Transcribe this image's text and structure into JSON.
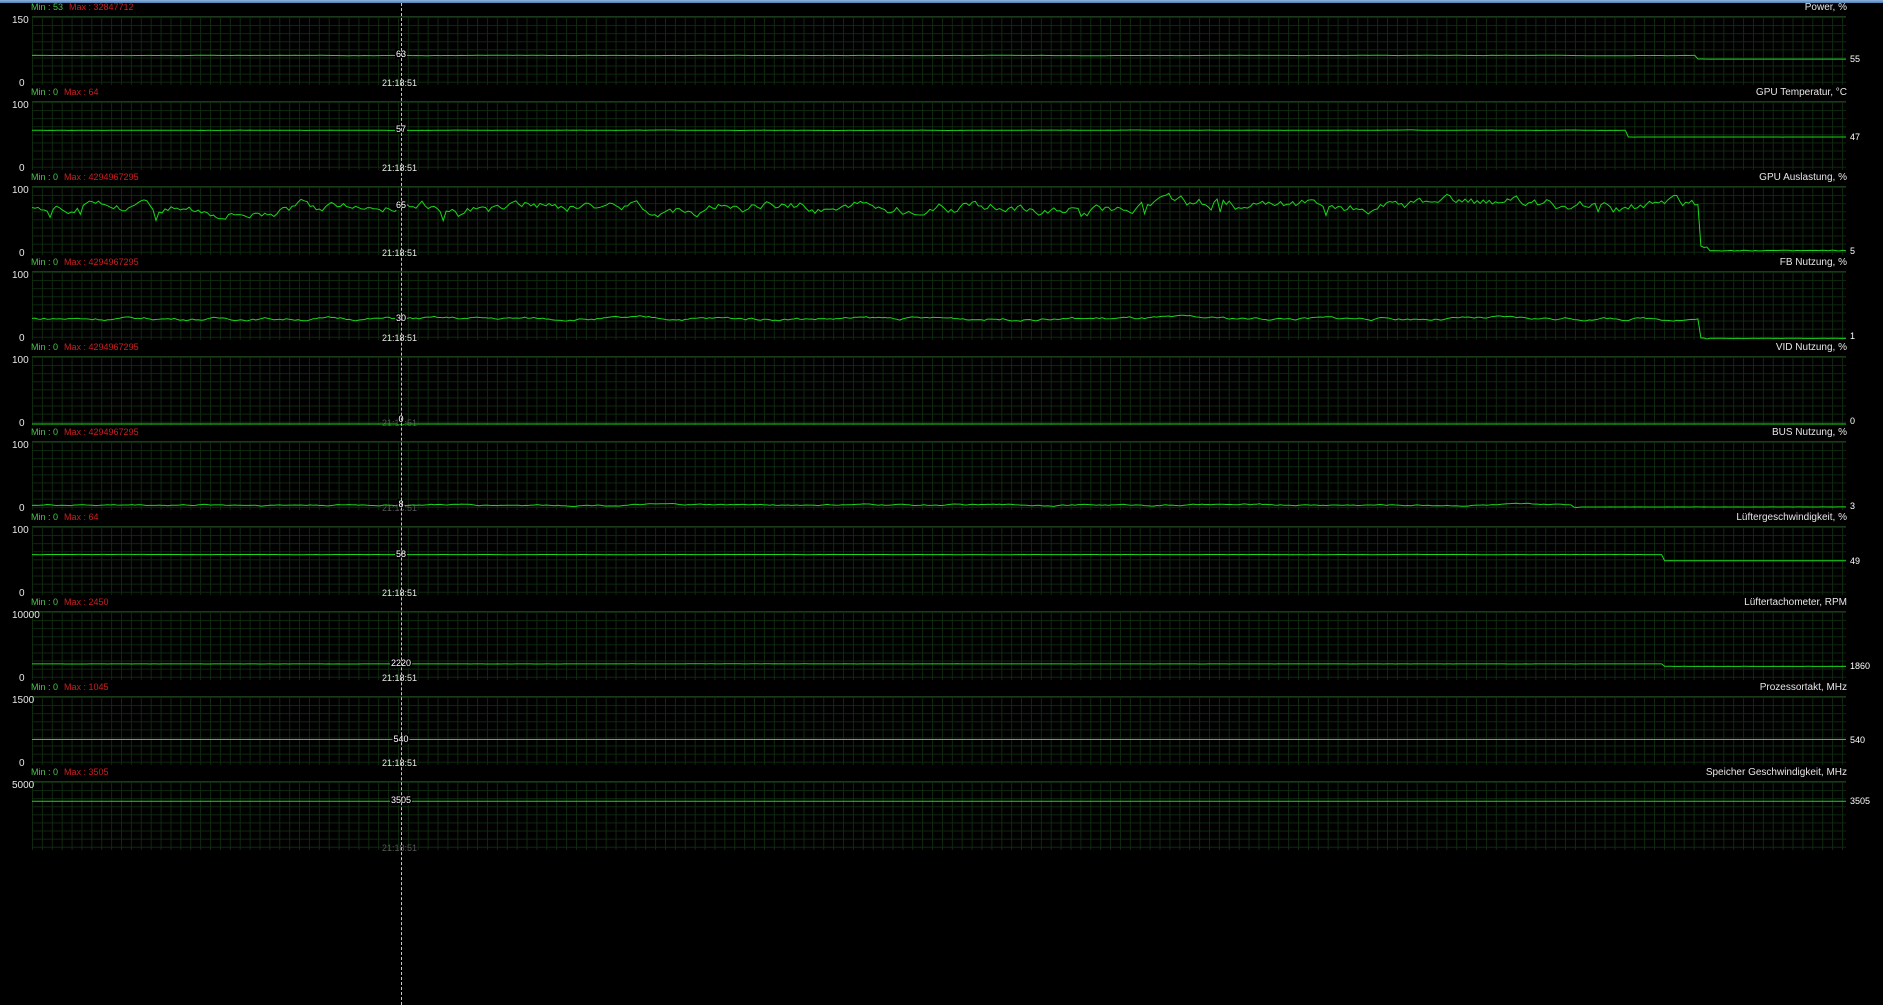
{
  "colors": {
    "trace": "#19d819",
    "min": "#4cc44c",
    "max": "#cc1f1f",
    "cursor": "#e8d040",
    "grid": "#0f2a0f"
  },
  "cursor_time": "21:18:51",
  "panels": [
    {
      "title": "Power, %",
      "min": "Min : 53",
      "max": "Max : 32847712",
      "ymax": 150,
      "ymin": 0,
      "ymax_label": "150",
      "ymin_label": "0",
      "cursor_value": "63",
      "current": "55",
      "level_before": 63,
      "level_after": 55,
      "drop_at": 0.917,
      "noise": 0.4,
      "time_visible": true
    },
    {
      "title": "GPU Temperatur, °C",
      "min": "Min : 0",
      "max": "Max : 64",
      "ymax": 100,
      "ymin": 0,
      "ymax_label": "100",
      "ymin_label": "0",
      "cursor_value": "57",
      "current": "47",
      "level_before": 57,
      "level_after": 47,
      "drop_at": 0.88,
      "noise": 0.3,
      "time_visible": true
    },
    {
      "title": "GPU Auslastung, %",
      "min": "Min : 0",
      "max": "Max : 4294967295",
      "ymax": 100,
      "ymin": 0,
      "ymax_label": "100",
      "ymin_label": "0",
      "cursor_value": "65",
      "current": "5",
      "level_before": 70,
      "level_after": 5,
      "drop_at": 0.92,
      "noise": 12,
      "time_visible": true
    },
    {
      "title": "FB Nutzung, %",
      "min": "Min : 0",
      "max": "Max : 4294967295",
      "ymax": 100,
      "ymin": 0,
      "ymax_label": "100",
      "ymin_label": "0",
      "cursor_value": "30",
      "current": "1",
      "level_before": 30,
      "level_after": 1,
      "drop_at": 0.92,
      "noise": 3,
      "time_visible": true
    },
    {
      "title": "VID Nutzung, %",
      "min": "Min : 0",
      "max": "Max : 4294967295",
      "ymax": 100,
      "ymin": 0,
      "ymax_label": "100",
      "ymin_label": "0",
      "cursor_value": "0",
      "current": "0",
      "level_before": 0,
      "level_after": 0,
      "drop_at": 1,
      "noise": 0,
      "time_visible": false
    },
    {
      "title": "BUS Nutzung, %",
      "min": "Min : 0",
      "max": "Max : 4294967295",
      "ymax": 100,
      "ymin": 0,
      "ymax_label": "100",
      "ymin_label": "0",
      "cursor_value": "8",
      "current": "3",
      "level_before": 6,
      "level_after": 3,
      "drop_at": 0.85,
      "noise": 1.5,
      "time_visible": false
    },
    {
      "title": "Lüftergeschwindigkeit, %",
      "min": "Min : 0",
      "max": "Max : 64",
      "ymax": 100,
      "ymin": 0,
      "ymax_label": "100",
      "ymin_label": "0",
      "cursor_value": "58",
      "current": "49",
      "level_before": 58,
      "level_after": 49,
      "drop_at": 0.9,
      "noise": 0.2,
      "time_visible": true
    },
    {
      "title": "Lüftertachometer, RPM",
      "min": "Min : 0",
      "max": "Max : 2450",
      "ymax": 10000,
      "ymin": 0,
      "ymax_label": "10000",
      "ymin_label": "0",
      "cursor_value": "2220",
      "current": "1860",
      "level_before": 2220,
      "level_after": 1860,
      "drop_at": 0.9,
      "noise": 10,
      "time_visible": true
    },
    {
      "title": "Prozessortakt, MHz",
      "min": "Min : 0",
      "max": "Max : 1045",
      "ymax": 1500,
      "ymin": 0,
      "ymax_label": "1500",
      "ymin_label": "0",
      "cursor_value": "540",
      "current": "540",
      "level_before": 540,
      "level_after": 540,
      "drop_at": 1,
      "noise": 0,
      "time_visible": true
    },
    {
      "title": "Speicher Geschwindigkeit, MHz",
      "min": "Min : 0",
      "max": "Max : 3505",
      "ymax": 5000,
      "ymin": 0,
      "ymax_label": "5000",
      "ymin_label": "",
      "cursor_value": "3505",
      "current": "3505",
      "level_before": 3505,
      "level_after": 3505,
      "drop_at": 1,
      "noise": 0,
      "time_visible": false
    }
  ]
}
